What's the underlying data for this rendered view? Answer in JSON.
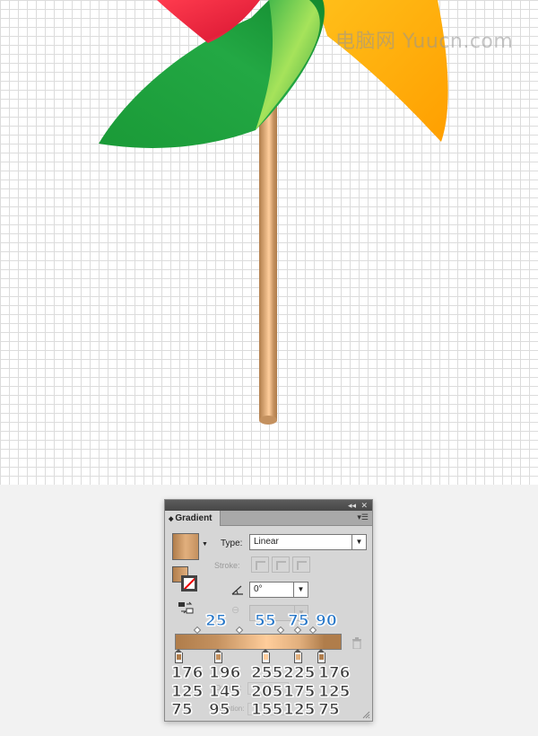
{
  "canvas": {
    "watermark": "电脑网 Yuucn.com",
    "grid_color": "#dcdcdc",
    "colors": {
      "red_blade": "#e8283c",
      "green_blade": "#1fa23d",
      "green_highlight": "#9fe05a",
      "orange_blade": "#ffb000",
      "stick_mid": "#f3c28e",
      "stick_edge": "#b47e4c"
    }
  },
  "panel": {
    "title": "Gradient",
    "type_label": "Type:",
    "type_value": "Linear",
    "stroke_label": "Stroke:",
    "angle_value": "0°",
    "faded_labels": [
      "Opacity:",
      "Location:"
    ],
    "icons": {
      "collapse": "double-chevron-icon",
      "close": "close-icon",
      "menu": "panel-menu-icon",
      "angle": "angle-icon",
      "reverse": "reverse-gradient-icon",
      "aspect": "aspect-ratio-icon",
      "trash": "trash-icon"
    },
    "gradient_stops": [
      {
        "location": 0,
        "rgb": [
          176,
          125,
          75
        ],
        "hex": "#b07d4b"
      },
      {
        "location": 25,
        "rgb": [
          196,
          145,
          95
        ],
        "hex": "#c4915f"
      },
      {
        "location": 55,
        "rgb": [
          255,
          205,
          155
        ],
        "hex": "#ffcd9b"
      },
      {
        "location": 75,
        "rgb": [
          225,
          175,
          125
        ],
        "hex": "#e1af7d"
      },
      {
        "location": 90,
        "rgb": [
          176,
          125,
          75
        ],
        "hex": "#b07d4b"
      }
    ]
  },
  "annotations": {
    "locations": [
      "25",
      "55",
      "75",
      "90"
    ],
    "rgb_labels": [
      {
        "r": "176",
        "g": "125",
        "b": "75"
      },
      {
        "r": "196",
        "g": "145",
        "b": "95"
      },
      {
        "r": "255",
        "g": "205",
        "b": "155"
      },
      {
        "r": "225",
        "g": "175",
        "b": "125"
      },
      {
        "r": "176",
        "g": "125",
        "b": "75"
      }
    ]
  }
}
